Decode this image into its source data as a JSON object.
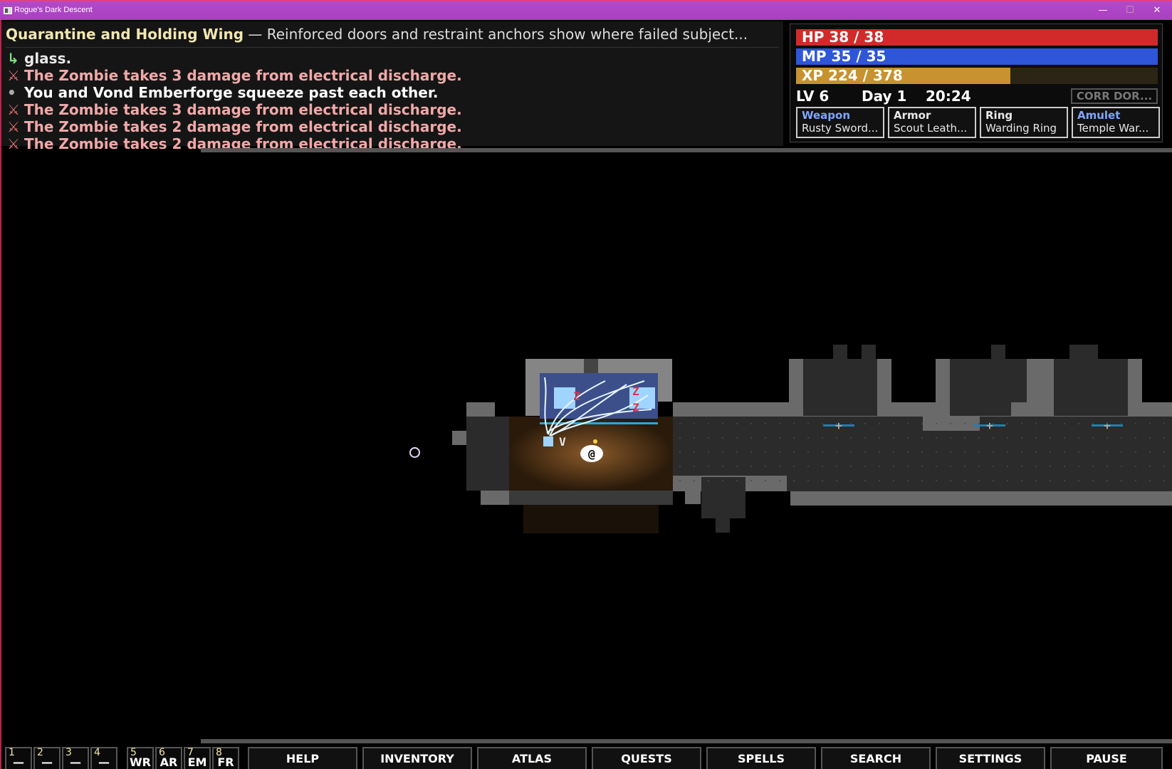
{
  "window": {
    "title": "Rogue's Dark Descent",
    "min_glyph": "—",
    "max_glyph": "☐",
    "close_glyph": "✕"
  },
  "log": {
    "zone": "Quarantine and Holding Wing",
    "description": " — Reinforced doors and restraint anchors show where failed subject...",
    "lines": [
      {
        "glyph": "↳",
        "text": "glass.",
        "kind": "cont"
      },
      {
        "glyph": "⚔",
        "text": "The Zombie takes 3 damage from electrical discharge.",
        "kind": "combat"
      },
      {
        "glyph": "•",
        "text": "You and Vond Emberforge squeeze past each other.",
        "kind": "info"
      },
      {
        "glyph": "⚔",
        "text": "The Zombie takes 3 damage from electrical discharge.",
        "kind": "combat"
      },
      {
        "glyph": "⚔",
        "text": "The Zombie takes 2 damage from electrical discharge.",
        "kind": "combat"
      },
      {
        "glyph": "⚔",
        "text": "The Zombie takes 2 damage from electrical discharge.",
        "kind": "combat"
      }
    ]
  },
  "stats": {
    "hp": {
      "label": "HP  38 / 38",
      "fraction": 1.0
    },
    "mp": {
      "label": "MP  35 / 35",
      "fraction": 1.0
    },
    "xp": {
      "label": "XP  224 / 378",
      "fraction": 0.5926
    },
    "level": "LV 6",
    "day": "Day 1",
    "time": "20:24",
    "location_button": "CORR DOR..."
  },
  "equipment": [
    {
      "slot": "Weapon",
      "item": "Rusty Sword...",
      "color": "#7fa6ff"
    },
    {
      "slot": "Armor",
      "item": "Scout Leath...",
      "color": "#e8e8e8"
    },
    {
      "slot": "Ring",
      "item": "Warding Ring",
      "color": "#e8e8e8"
    },
    {
      "slot": "Amulet",
      "item": "Temple War...",
      "color": "#7fa6ff"
    }
  ],
  "map": {
    "zombie_glyph": "Z",
    "door_glyph": "+",
    "ally_glyph": "V",
    "player_glyph": "@"
  },
  "hotbar": {
    "slots": [
      {
        "num": "1",
        "label": "—"
      },
      {
        "num": "2",
        "label": "—"
      },
      {
        "num": "3",
        "label": "—"
      },
      {
        "num": "4",
        "label": "—"
      },
      {
        "num": "5",
        "label": "WR"
      },
      {
        "num": "6",
        "label": "AR"
      },
      {
        "num": "7",
        "label": "EM"
      },
      {
        "num": "8",
        "label": "FR"
      }
    ],
    "buttons": [
      "HELP",
      "INVENTORY",
      "ATLAS",
      "QUESTS",
      "SPELLS",
      "SEARCH",
      "SETTINGS",
      "PAUSE"
    ]
  },
  "colors": {
    "hp": "#d22a2a",
    "mp": "#2f56d8",
    "xp": "#c7922f",
    "zone_title": "#f2e6b0",
    "combat_text": "#f0a8a8",
    "equip_highlight": "#7fa6ff"
  }
}
